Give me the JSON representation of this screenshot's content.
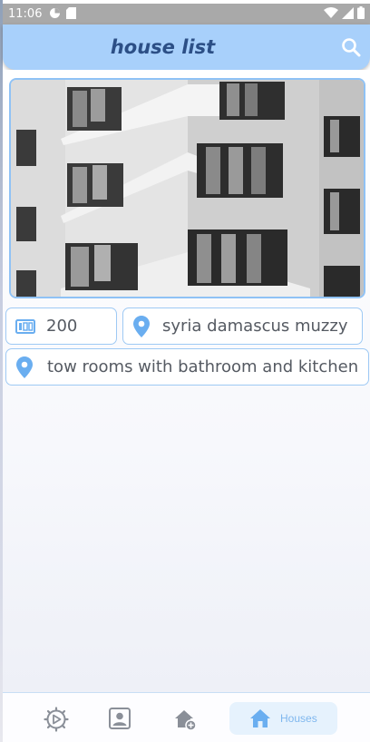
{
  "status_bar": {
    "time": "11:06"
  },
  "app_bar": {
    "title": "house list"
  },
  "house": {
    "price": "200",
    "location": "syria damascus muzzy",
    "description": "tow rooms with bathroom and kitchen"
  },
  "bottom_nav": {
    "items": [
      {
        "icon": "settings-icon"
      },
      {
        "icon": "profile-icon"
      },
      {
        "icon": "add-home-icon"
      },
      {
        "icon": "home-icon",
        "label": "Houses",
        "active": true
      }
    ]
  },
  "colors": {
    "app_bar": "#a8d0fb",
    "title": "#2c4f86",
    "accent": "#6aaef0",
    "field_border": "#9ec9f4"
  }
}
